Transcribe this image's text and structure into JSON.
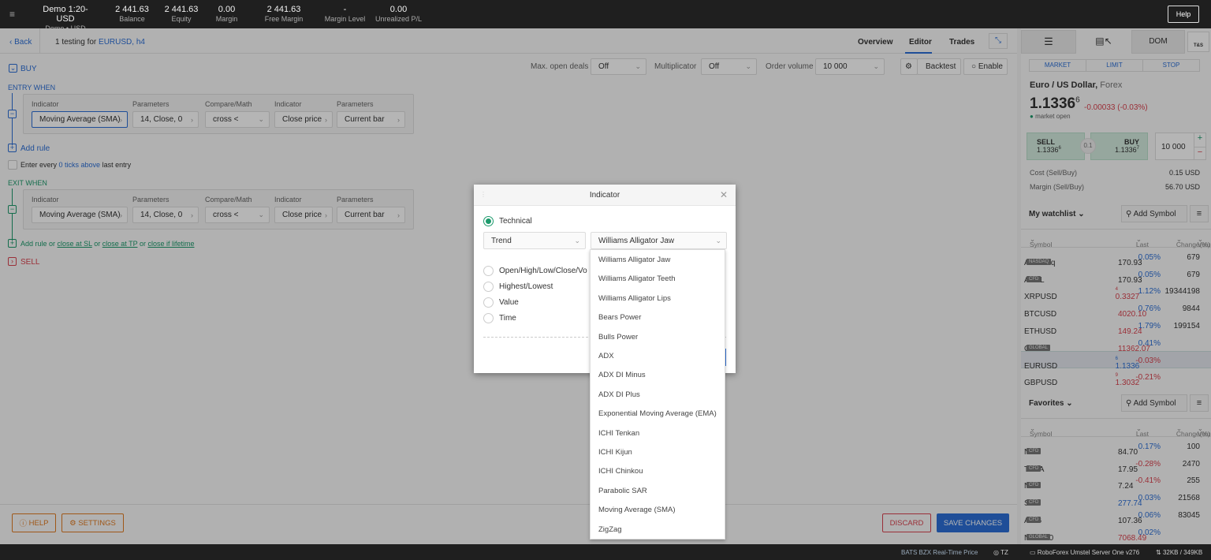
{
  "topbar": {
    "account": "Demo 1:20-USD",
    "account_sub": "Demo • USD",
    "stats": [
      {
        "value": "2 441.63",
        "label": "Balance"
      },
      {
        "value": "2 441.63",
        "label": "Equity"
      },
      {
        "value": "0.00",
        "label": "Margin"
      },
      {
        "value": "2 441.63",
        "label": "Free Margin"
      },
      {
        "value": "-",
        "label": "Margin Level"
      },
      {
        "value": "0.00",
        "label": "Unrealized P/L"
      }
    ],
    "help": "Help"
  },
  "header": {
    "back": "Back",
    "title_prefix": "1 testing for ",
    "title_symbol": "EURUSD, h4",
    "tabs": [
      "Overview",
      "Editor",
      "Trades"
    ],
    "active_tab": "Editor"
  },
  "toolbar": {
    "buy": "BUY",
    "max_open_deals_label": "Max. open deals",
    "max_open_deals": "Off",
    "multiplicator_label": "Multiplicator",
    "multiplicator": "Off",
    "order_volume_label": "Order volume",
    "order_volume": "10 000",
    "backtest": "Backtest",
    "enable": "Enable"
  },
  "entry": {
    "title": "ENTRY WHEN",
    "headers": [
      "Indicator",
      "Parameters",
      "Compare/Math",
      "Indicator",
      "Parameters"
    ],
    "values": [
      "Moving Average (SMA)",
      "14, Close, 0",
      "cross <",
      "Close price",
      "Current bar"
    ],
    "add_rule": "Add rule",
    "enter_every_1": "Enter every ",
    "enter_every_link": "0 ticks above",
    "enter_every_2": " last entry"
  },
  "exit": {
    "title": "EXIT WHEN",
    "headers": [
      "Indicator",
      "Parameters",
      "Compare/Math",
      "Indicator",
      "Parameters"
    ],
    "values": [
      "Moving Average (SMA)",
      "14, Close, 0",
      "cross <",
      "Close price",
      "Current bar"
    ],
    "add_rule": "Add rule",
    "or": " or ",
    "close_sl": "close at SL",
    "close_tp": "close at TP",
    "close_lifetime": "close if lifetime"
  },
  "sell": "SELL",
  "footer": {
    "help": "HELP",
    "settings": "SETTINGS",
    "discard": "DISCARD",
    "save": "SAVE CHANGES"
  },
  "modal": {
    "title": "Indicator",
    "options": [
      "Technical",
      "Open/High/Low/Close/Vo",
      "Highest/Lowest",
      "Value",
      "Time"
    ],
    "selected_option": "Technical",
    "category": "Trend",
    "indicator": "Williams Alligator Jaw",
    "list": [
      "Williams Alligator Jaw",
      "Williams Alligator Teeth",
      "Williams Alligator Lips",
      "Bears Power",
      "Bulls Power",
      "ADX",
      "ADX DI Minus",
      "ADX DI Plus",
      "Exponential Moving Average (EMA)",
      "ICHI Tenkan",
      "ICHI Kijun",
      "ICHI Chinkou",
      "Parabolic SAR",
      "Moving Average (SMA)",
      "ZigZag"
    ]
  },
  "panel": {
    "tabs": [
      "DOM",
      "T&S"
    ],
    "order_types": [
      "MARKET",
      "LIMIT",
      "STOP"
    ],
    "instrument": "Euro / US Dollar,",
    "instrument_type": " Forex",
    "price": "1.1336",
    "price_sup": "6",
    "change": "-0.00033 (-0.03%)",
    "market_status": "market open",
    "sell_label": "SELL",
    "sell_price": "1.1336",
    "sell_sup": "6",
    "buy_label": "BUY",
    "buy_price": "1.1336",
    "buy_sup": "7",
    "spread": "0.1",
    "volume": "10 000",
    "cost_label": "Cost (Sell/Buy)",
    "cost": "0.15 USD",
    "margin_label": "Margin (Sell/Buy)",
    "margin": "56.70 USD",
    "add_symbol": "Add Symbol",
    "columns": [
      "Symbol",
      "Last",
      "Change(%)",
      "Volume"
    ],
    "watchlist": {
      "title": "My watchlist",
      "rows": [
        {
          "symbol": "AAPL.nq",
          "badge": "NASDAQ",
          "last": "170.93",
          "change": "0.05%",
          "volume": "679",
          "lc": "n",
          "cc": "b"
        },
        {
          "symbol": "AAPL",
          "badge": "CFD",
          "last": "170.93",
          "change": "0.05%",
          "volume": "679",
          "lc": "n",
          "cc": "b"
        },
        {
          "symbol": "XRPUSD",
          "badge": "",
          "last": "0.3327",
          "sup": "4",
          "change": "1.12%",
          "volume": "19344198",
          "lc": "r",
          "cc": "b"
        },
        {
          "symbol": "BTCUSD",
          "badge": "",
          "last": "4020.10",
          "change": "0.76%",
          "volume": "9844",
          "lc": "r",
          "cc": "b"
        },
        {
          "symbol": "ETHUSD",
          "badge": "",
          "last": "149.24",
          "change": "1.79%",
          "volume": "199154",
          "lc": "r",
          "cc": "b"
        },
        {
          "symbol": "GER30",
          "badge": "GLOBAL",
          "last": "11362.07",
          "change": "0.41%",
          "volume": "",
          "lc": "r",
          "cc": "b"
        },
        {
          "symbol": "EURUSD",
          "badge": "",
          "last": "1.1336",
          "sup": "6",
          "change": "-0.03%",
          "volume": "",
          "lc": "b",
          "cc": "r"
        },
        {
          "symbol": "GBPUSD",
          "badge": "",
          "last": "1.3032",
          "sup": "9",
          "change": "-0.21%",
          "volume": "",
          "lc": "r",
          "cc": "r"
        }
      ]
    },
    "favorites": {
      "title": "Favorites",
      "rows": [
        {
          "symbol": "NKE",
          "badge": "CFD",
          "last": "84.70",
          "change": "0.17%",
          "volume": "100",
          "lc": "n",
          "cc": "b"
        },
        {
          "symbol": "TEVA",
          "badge": "CFD",
          "last": "17.95",
          "change": "-0.28%",
          "volume": "2470",
          "lc": "n",
          "cc": "r"
        },
        {
          "symbol": "NIO",
          "badge": "CFD",
          "last": "7.24",
          "change": "-0.41%",
          "volume": "255",
          "lc": "n",
          "cc": "r"
        },
        {
          "symbol": "SPY",
          "badge": "CFD",
          "last": "277.74",
          "change": "0.03%",
          "volume": "21568",
          "lc": "b",
          "cc": "b"
        },
        {
          "symbol": "AGG",
          "badge": "CFD",
          "last": "107.36",
          "change": "0.06%",
          "volume": "83045",
          "lc": "n",
          "cc": "b"
        },
        {
          "symbol": "NAS100",
          "badge": "GLOBAL",
          "last": "7068.49",
          "change": "0.02%",
          "volume": "",
          "lc": "r",
          "cc": "b"
        }
      ]
    }
  },
  "status": {
    "feed": "BATS BZX Real-Time Price",
    "tz": "TZ",
    "server": "RoboForex Umstel Server One v276",
    "traffic": "32KB / 349KB"
  },
  "colors": {
    "accent": "#2c6fd6",
    "buy_green": "#1d9a6c",
    "sell_red": "#d9434f",
    "orange": "#e07b22"
  }
}
